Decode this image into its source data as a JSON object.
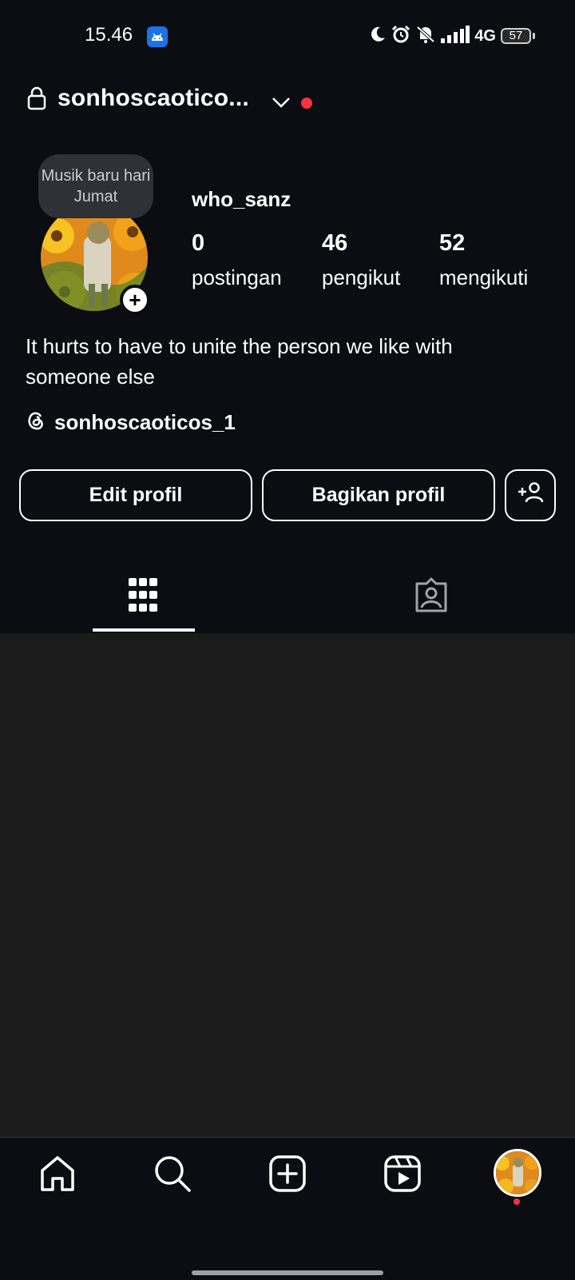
{
  "status_bar": {
    "time": "15.46",
    "network": "4G",
    "battery": "57",
    "icons": [
      "moon-icon",
      "alarm-icon",
      "vibrate-off-icon",
      "signal-icon"
    ]
  },
  "header": {
    "username": "sonhoscaotico...",
    "icons": [
      "lock-icon",
      "chevron-down-icon",
      "notification-dot"
    ]
  },
  "profile": {
    "note": "Musik baru hari Jumat",
    "display_name": "who_sanz",
    "stats": [
      {
        "value": "0",
        "label": "postingan"
      },
      {
        "value": "46",
        "label": "pengikut"
      },
      {
        "value": "52",
        "label": "mengikuti"
      }
    ],
    "bio": "It hurts to have to unite the person we like with someone else",
    "threads_handle": "sonhoscaoticos_1"
  },
  "actions": {
    "edit_label": "Edit profil",
    "share_label": "Bagikan profil",
    "add_icon": "add-person-icon"
  },
  "tabs": {
    "items": [
      "grid-icon",
      "tagged-icon"
    ],
    "active": "grid-icon"
  },
  "bottom_nav": {
    "items": [
      "home-icon",
      "search-icon",
      "create-icon",
      "reels-icon",
      "profile-avatar"
    ]
  },
  "colors": {
    "background": "#0b0d12",
    "content_background": "#1b1b1b",
    "notification_red": "#ff3040",
    "app_badge_blue": "#1a73e8"
  }
}
